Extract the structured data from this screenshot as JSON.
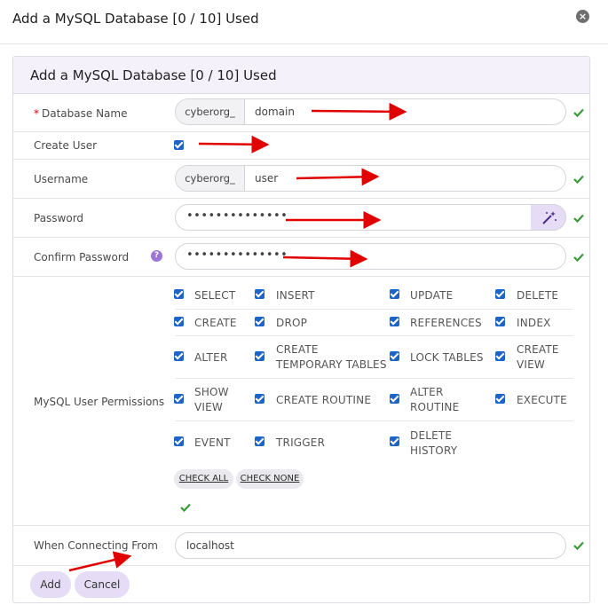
{
  "modal": {
    "title": "Add a MySQL Database [0 / 10] Used",
    "close_icon": "close-icon"
  },
  "panel": {
    "title": "Add a MySQL Database [0 / 10] Used"
  },
  "form": {
    "database_name": {
      "label": "Database Name",
      "required_mark": "*",
      "prefix": "cyberorg_",
      "value": "domain"
    },
    "create_user": {
      "label": "Create User",
      "checked": true
    },
    "username": {
      "label": "Username",
      "prefix": "cyberorg_",
      "value": "user"
    },
    "password": {
      "label": "Password",
      "value": "••••••••••••••",
      "generate_icon": "magic-wand-icon"
    },
    "confirm_password": {
      "label": "Confirm Password",
      "value": "••••••••••••••",
      "help_icon": "?"
    },
    "permissions": {
      "label": "MySQL User Permissions",
      "items": [
        {
          "name": "SELECT",
          "checked": true
        },
        {
          "name": "INSERT",
          "checked": true
        },
        {
          "name": "UPDATE",
          "checked": true
        },
        {
          "name": "DELETE",
          "checked": true
        },
        {
          "name": "CREATE",
          "checked": true
        },
        {
          "name": "DROP",
          "checked": true
        },
        {
          "name": "REFERENCES",
          "checked": true
        },
        {
          "name": "INDEX",
          "checked": true
        },
        {
          "name": "ALTER",
          "checked": true
        },
        {
          "name": "CREATE TEMPORARY TABLES",
          "line1": "CREATE",
          "line2": "TEMPORARY TABLES",
          "checked": true
        },
        {
          "name": "LOCK TABLES",
          "checked": true
        },
        {
          "name": "CREATE VIEW",
          "line1": "CREATE",
          "line2": "VIEW",
          "checked": true
        },
        {
          "name": "SHOW VIEW",
          "line1": "SHOW",
          "line2": "VIEW",
          "checked": true
        },
        {
          "name": "CREATE ROUTINE",
          "checked": true
        },
        {
          "name": "ALTER ROUTINE",
          "line1": "ALTER",
          "line2": "ROUTINE",
          "checked": true
        },
        {
          "name": "EXECUTE",
          "checked": true
        },
        {
          "name": "EVENT",
          "checked": true
        },
        {
          "name": "TRIGGER",
          "checked": true
        },
        {
          "name": "DELETE HISTORY",
          "line1": "DELETE",
          "line2": "HISTORY",
          "checked": true
        }
      ],
      "check_all_label": "CHECK ALL",
      "check_none_label": "CHECK NONE"
    },
    "connecting_from": {
      "label": "When Connecting From",
      "value": "localhost"
    }
  },
  "actions": {
    "add_label": "Add",
    "cancel_label": "Cancel"
  },
  "colors": {
    "accent": "#e7dcf5",
    "checkbox": "#1e64c8",
    "valid": "#3a9a3a",
    "annotation_arrow": "#e00000"
  }
}
